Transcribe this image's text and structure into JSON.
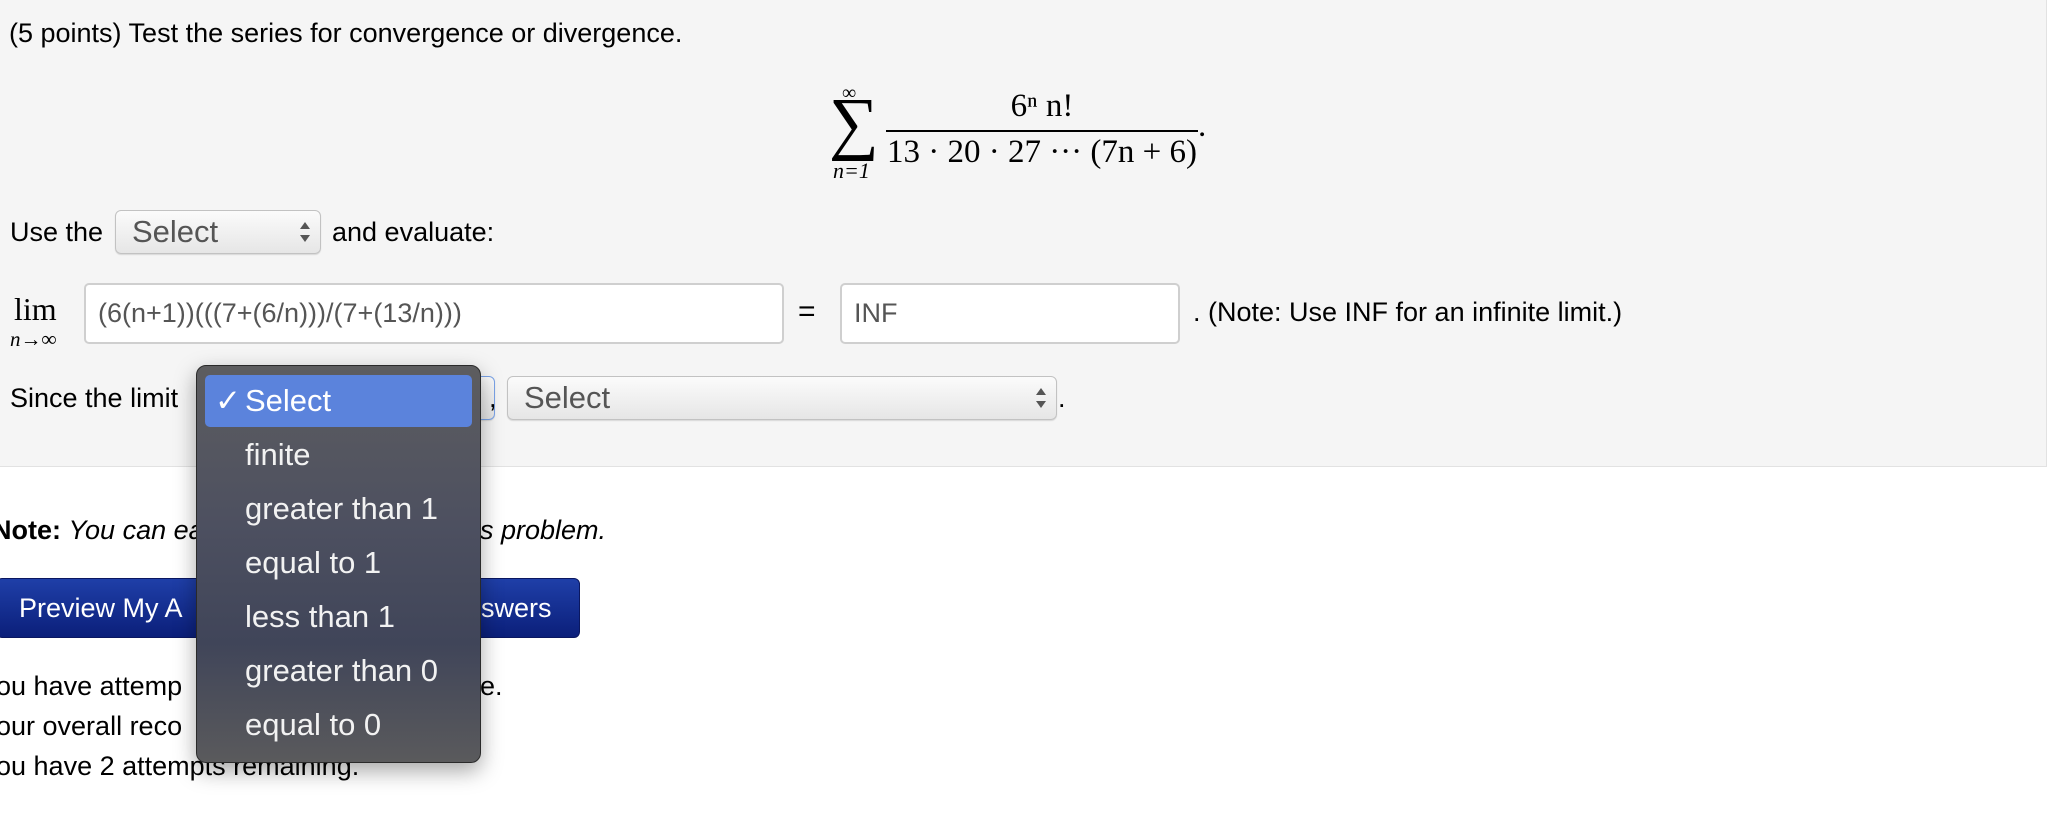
{
  "problem": {
    "title": "(5 points) Test the series for convergence or divergence.",
    "series": {
      "upper": "∞",
      "sigma": "∑",
      "lower": "n=1",
      "numerator": "6ⁿ n!",
      "denominator": "13 · 20 · 27 ··· (7n + 6)",
      "trailing": "."
    },
    "use_the_label": "Use the",
    "test_select": {
      "value": "Select"
    },
    "and_evaluate": "and evaluate:",
    "limit": {
      "lim": "lim",
      "sub": "n→∞",
      "expression_value": "(6(n+1))(((7+(6/n)))/(7+(13/n)))",
      "equals": "=",
      "result_value": "INF",
      "note": ". (Note: Use INF for an infinite limit.)"
    },
    "since_label": "Since the limit",
    "comma": ",",
    "conclusion_select": {
      "value": "Select"
    },
    "period": "."
  },
  "dropdown": {
    "selected_index": 0,
    "check": "✓",
    "options": [
      "Select",
      "finite",
      "greater than 1",
      "equal to 1",
      "less than 1",
      "greater than 0",
      "equal to 0"
    ]
  },
  "note": {
    "label": "Note:",
    "text_visible_left": "You can ea",
    "text_visible_right": "s problem."
  },
  "buttons": {
    "preview_visible": "Preview My A",
    "submit_visible": "swers"
  },
  "status": {
    "line1_left": "ou have attemp",
    "line1_right": "e.",
    "line2_left": "our overall reco",
    "line3": "ou have 2 attempts remaining."
  },
  "colors": {
    "panel_bg": "#f5f5f5",
    "button_blue": "#0b1f7a",
    "dropdown_highlight": "#5b83dc",
    "dropdown_bg": "#4d5060"
  }
}
